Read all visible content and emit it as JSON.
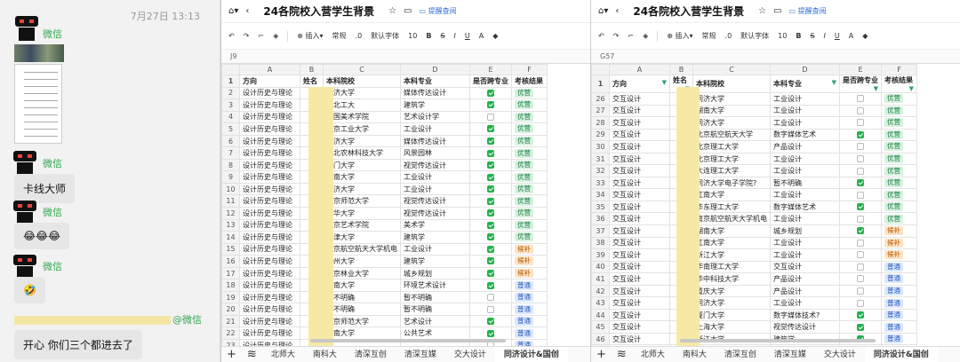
{
  "chat": {
    "timestamp": "7月27日 13:13",
    "name1": "微信",
    "name2": "微信",
    "name3": "微信",
    "name4": "微信",
    "msg_kaxian": "卡线大师",
    "msg_emoji1": "😂😂😂",
    "msg_emoji2": "🤣",
    "mention_suffix": "@微信",
    "msg_last": "开心 你们三个都进去了"
  },
  "left": {
    "title": "24各院校入营学生背景",
    "feedback": "提醒查阅",
    "toolbar": {
      "insert": "插入",
      "format": "常规",
      "decimal": ".0",
      "font": "默认字体",
      "size": "10"
    },
    "cellref": "J9",
    "columns": [
      "",
      "A",
      "B",
      "C",
      "D",
      "E",
      "F"
    ],
    "header": {
      "rn": "1",
      "dir": "方向",
      "name": "姓名",
      "school": "本科院校",
      "major": "本科专业",
      "cross": "是否跨专业",
      "result": "考核结果"
    },
    "rows": [
      {
        "rn": "2",
        "dir": "设计历史与理论",
        "school": "同济大学",
        "major": "媒体传达设计",
        "cross": true,
        "result": "优营"
      },
      {
        "rn": "3",
        "dir": "设计历史与理论",
        "school": "西北工大",
        "major": "建筑学",
        "cross": true,
        "result": "优营"
      },
      {
        "rn": "4",
        "dir": "设计历史与理论",
        "school": "中国美术学院",
        "major": "艺术设计学",
        "cross": false,
        "result": "优营"
      },
      {
        "rn": "5",
        "dir": "设计历史与理论",
        "school": "北京工业大学",
        "major": "工业设计",
        "cross": true,
        "result": "优营"
      },
      {
        "rn": "6",
        "dir": "设计历史与理论",
        "school": "同济大学",
        "major": "媒体传达设计",
        "cross": true,
        "result": "优营"
      },
      {
        "rn": "7",
        "dir": "设计历史与理论",
        "school": "西北农林科技大学",
        "major": "风景园林",
        "cross": true,
        "result": "优营"
      },
      {
        "rn": "8",
        "dir": "设计历史与理论",
        "school": "厦门大学",
        "major": "视觉传达设计",
        "cross": true,
        "result": "优营"
      },
      {
        "rn": "9",
        "dir": "设计历史与理论",
        "school": "湖南大学",
        "major": "工业设计",
        "cross": true,
        "result": "优营"
      },
      {
        "rn": "10",
        "dir": "设计历史与理论",
        "school": "同济大学",
        "major": "工业设计",
        "cross": true,
        "result": "优营"
      },
      {
        "rn": "11",
        "dir": "设计历史与理论",
        "school": "南京师范大学",
        "major": "视觉传达设计",
        "cross": true,
        "result": "优营"
      },
      {
        "rn": "12",
        "dir": "设计历史与理论",
        "school": "东华大学",
        "major": "视觉传达设计",
        "cross": true,
        "result": "优营"
      },
      {
        "rn": "13",
        "dir": "设计历史与理论",
        "school": "南京艺术学院",
        "major": "美术学",
        "cross": true,
        "result": "优营"
      },
      {
        "rn": "14",
        "dir": "设计历史与理论",
        "school": "天津大学",
        "major": "建筑学",
        "cross": true,
        "result": "优营"
      },
      {
        "rn": "15",
        "dir": "设计历史与理论",
        "school": "南京航空航天大学机电",
        "major": "工业设计",
        "cross": true,
        "result": "候补"
      },
      {
        "rn": "16",
        "dir": "设计历史与理论",
        "school": "郑州大学",
        "major": "建筑学",
        "cross": true,
        "result": "候补"
      },
      {
        "rn": "17",
        "dir": "设计历史与理论",
        "school": "南京林业大学",
        "major": "城乡规划",
        "cross": true,
        "result": "候补"
      },
      {
        "rn": "18",
        "dir": "设计历史与理论",
        "school": "江南大学",
        "major": "环境艺术设计",
        "cross": true,
        "result": "普通"
      },
      {
        "rn": "19",
        "dir": "设计历史与理论",
        "school": "暂不明确",
        "major": "暂不明确",
        "cross": false,
        "result": "普通"
      },
      {
        "rn": "20",
        "dir": "设计历史与理论",
        "school": "暂不明确",
        "major": "暂不明确",
        "cross": false,
        "result": "普通"
      },
      {
        "rn": "21",
        "dir": "设计历史与理论",
        "school": "北京师范大学",
        "major": "艺术设计",
        "cross": true,
        "result": "普通"
      },
      {
        "rn": "22",
        "dir": "设计历史与理论",
        "school": "江南大学",
        "major": "公共艺术",
        "cross": true,
        "result": "普通"
      },
      {
        "rn": "23",
        "dir": "设计历史与理论",
        "school": "",
        "major": "",
        "cross": false,
        "result": "普通"
      }
    ],
    "tabs": [
      "北师大",
      "南科大",
      "清深互创",
      "清深互媒",
      "交大设计",
      "同济设计&国创"
    ]
  },
  "right": {
    "title": "24各院校入营学生背景",
    "feedback": "提醒查阅",
    "toolbar": {
      "insert": "插入",
      "format": "常规",
      "decimal": ".0",
      "font": "默认字体",
      "size": "10"
    },
    "cellref": "G57",
    "columns": [
      "",
      "A",
      "B",
      "C",
      "D",
      "E",
      "F"
    ],
    "header": {
      "rn": "1",
      "dir": "方向",
      "name": "姓名",
      "school": "本科院校",
      "major": "本科专业",
      "cross": "是否跨专业",
      "result": "考核结果"
    },
    "rows": [
      {
        "rn": "26",
        "dir": "交互设计",
        "school": "同济大学",
        "major": "工业设计",
        "cross": false,
        "result": "优营"
      },
      {
        "rn": "27",
        "dir": "交互设计",
        "school": "湖南大学",
        "major": "工业设计",
        "cross": false,
        "result": "优营"
      },
      {
        "rn": "28",
        "dir": "交互设计",
        "school": "同济大学",
        "major": "工业设计",
        "cross": false,
        "result": "优营"
      },
      {
        "rn": "29",
        "dir": "交互设计",
        "school": "北京航空航天大学",
        "major": "数字媒体艺术",
        "cross": true,
        "result": "优营"
      },
      {
        "rn": "30",
        "dir": "交互设计",
        "school": "北京理工大学",
        "major": "产品设计",
        "cross": false,
        "result": "优营"
      },
      {
        "rn": "31",
        "dir": "交互设计",
        "school": "北京理工大学",
        "major": "工业设计",
        "cross": false,
        "result": "优营"
      },
      {
        "rn": "32",
        "dir": "交互设计",
        "school": "大连理工大学",
        "major": "工业设计",
        "cross": false,
        "result": "优营"
      },
      {
        "rn": "33",
        "dir": "交互设计",
        "school": "同济大学电子学院?",
        "major": "暂不明确",
        "cross": true,
        "result": "优营"
      },
      {
        "rn": "34",
        "dir": "交互设计",
        "school": "江南大学",
        "major": "工业设计",
        "cross": false,
        "result": "优营"
      },
      {
        "rn": "35",
        "dir": "交互设计",
        "school": "华东理工大学",
        "major": "数字媒体艺术",
        "cross": true,
        "result": "优营"
      },
      {
        "rn": "36",
        "dir": "交互设计",
        "school": "南京航空航天大学机电",
        "major": "工业设计",
        "cross": false,
        "result": "优营"
      },
      {
        "rn": "37",
        "dir": "交互设计",
        "school": "湖南大学",
        "major": "城乡规划",
        "cross": true,
        "result": "候补"
      },
      {
        "rn": "38",
        "dir": "交互设计",
        "school": "江南大学",
        "major": "工业设计",
        "cross": false,
        "result": "候补"
      },
      {
        "rn": "39",
        "dir": "交互设计",
        "school": "浙江大学",
        "major": "工业设计",
        "cross": false,
        "result": "候补"
      },
      {
        "rn": "40",
        "dir": "交互设计",
        "school": "华南理工大学",
        "major": "交互设计",
        "cross": false,
        "result": "普通"
      },
      {
        "rn": "41",
        "dir": "交互设计",
        "school": "华中科技大学",
        "major": "产品设计",
        "cross": false,
        "result": "普通"
      },
      {
        "rn": "42",
        "dir": "交互设计",
        "school": "重庆大学",
        "major": "产品设计",
        "cross": false,
        "result": "普通"
      },
      {
        "rn": "43",
        "dir": "交互设计",
        "school": "同济大学",
        "major": "工业设计",
        "cross": false,
        "result": "普通"
      },
      {
        "rn": "44",
        "dir": "交互设计",
        "school": "厦门大学",
        "major": "数字媒体技术?",
        "cross": true,
        "result": "普通"
      },
      {
        "rn": "45",
        "dir": "交互设计",
        "school": "上海大学",
        "major": "视觉传达设计",
        "cross": true,
        "result": "普通"
      },
      {
        "rn": "46",
        "dir": "交互设计",
        "school": "浙江大学",
        "major": "建筑学",
        "cross": true,
        "result": "普通"
      },
      {
        "rn": "47",
        "dir": "交互设计",
        "school": "",
        "major": "",
        "cross": true,
        "result": "普通"
      }
    ],
    "tabs": [
      "北师大",
      "南科大",
      "清深互创",
      "清深互媒",
      "交大设计",
      "同济设计&国创"
    ]
  },
  "colors": {
    "good": "#d7f1df",
    "good_text": "#127a3a",
    "wait": "#fde3c7",
    "wait_text": "#b35a00",
    "normal": "#dbe7fb",
    "normal_text": "#2a5bb5",
    "check": "#21b24a",
    "wechat_green": "#2fa84f"
  }
}
